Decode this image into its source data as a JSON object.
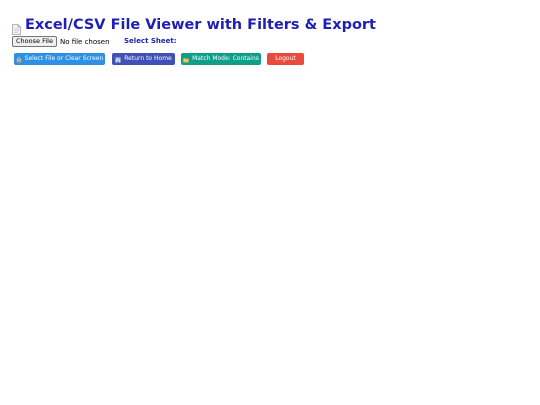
{
  "header": {
    "icon": "document-icon",
    "title": "Excel/CSV File Viewer with Filters & Export"
  },
  "file_input": {
    "button_label": "Choose File",
    "status_text": "No file chosen"
  },
  "sheet": {
    "label": "Select Sheet:"
  },
  "actions": {
    "select_file_label": "Select File or Clear Screen",
    "select_file_icon": "home-icon",
    "return_home_label": "Return to Home",
    "return_home_icon": "building-icon",
    "match_mode_label": "Match Mode: Contains",
    "match_mode_icon": "folder-icon",
    "logout_label": "Logout"
  },
  "colors": {
    "title": "#1f1fb3",
    "select_file": "#2e8fe6",
    "return_home": "#3f51b5",
    "match_mode": "#0f9e8a",
    "logout": "#ea4a3c"
  }
}
